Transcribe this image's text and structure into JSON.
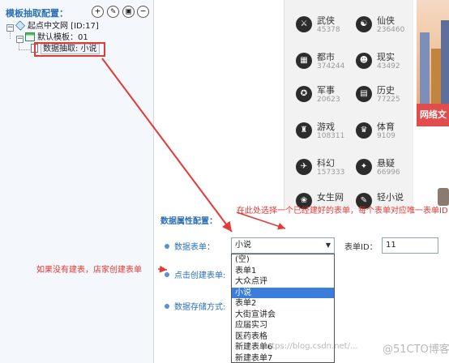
{
  "template_panel": {
    "title": "模板抽取配置：",
    "toolbar_icons": [
      "add-icon",
      "edit-icon",
      "save-icon",
      "remove-icon"
    ],
    "tree": {
      "root": "起点中文网 [ID:17]",
      "child": "默认模板：01",
      "leaf": "数据抽取: 小说"
    }
  },
  "categories": [
    {
      "name": "武侠",
      "count": "45378",
      "icon": "sword-icon"
    },
    {
      "name": "仙侠",
      "count": "236460",
      "icon": "fairy-icon"
    },
    {
      "name": "都市",
      "count": "374244",
      "icon": "city-icon"
    },
    {
      "name": "现实",
      "count": "43492",
      "icon": "person-icon"
    },
    {
      "name": "军事",
      "count": "20623",
      "icon": "military-icon"
    },
    {
      "name": "历史",
      "count": "77225",
      "icon": "history-icon"
    },
    {
      "name": "游戏",
      "count": "108311",
      "icon": "game-icon"
    },
    {
      "name": "体育",
      "count": "9109",
      "icon": "trophy-icon"
    },
    {
      "name": "科幻",
      "count": "157333",
      "icon": "scifi-icon"
    },
    {
      "name": "悬疑",
      "count": "66996",
      "icon": "mystery-icon"
    },
    {
      "name": "女生网",
      "count": "",
      "icon": "female-icon"
    },
    {
      "name": "轻小说",
      "count": "",
      "icon": "lightnovel-icon"
    }
  ],
  "banner_text": "网络文",
  "attr_panel": {
    "title": "数据属性配置：",
    "form_label": "数据表单：",
    "create_label": "点击创建表单:",
    "storage_label": "数据存储方式:",
    "form_select_value": "小说",
    "form_id_label": "表单ID：",
    "form_id_value": "11",
    "dropdown_options": [
      "(空)",
      "表单1",
      "大众点评",
      "小说",
      "表单2",
      "大街宣讲会",
      "应届实习",
      "医药表格",
      "新建表单6",
      "新建表单7"
    ],
    "selected_index": 3
  },
  "annotations": {
    "right": "在此处选择一个已经建好的表单，每个表单对应唯一表单ID",
    "left": "如果没有建表，店家创建表单"
  },
  "colors": {
    "annotation_red": "#e53935",
    "link_blue": "#2a6fb8",
    "selected_blue": "#3b7ddd"
  },
  "watermark": {
    "url": "https://blog.csdn.net/...",
    "brand": "@51CTO博客"
  }
}
